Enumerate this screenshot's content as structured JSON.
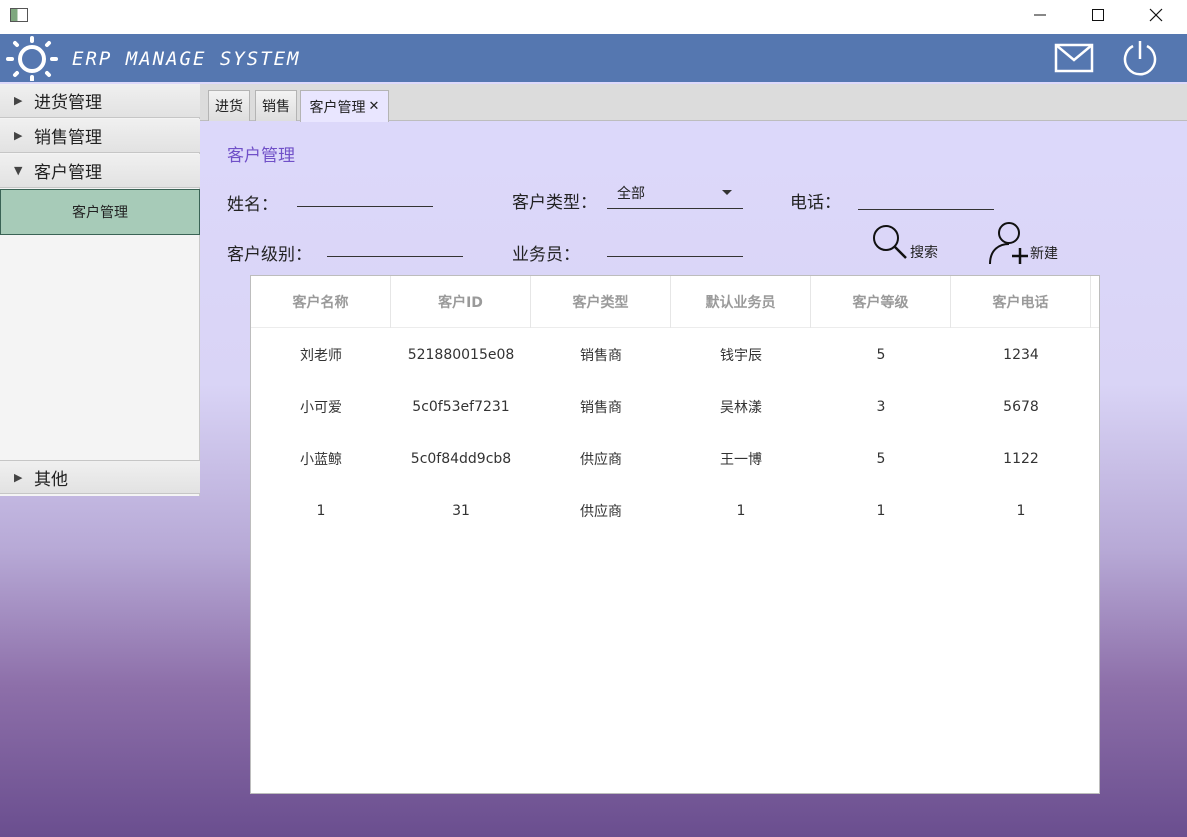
{
  "header": {
    "title": "ERP MANAGE SYSTEM"
  },
  "sidebar": {
    "sections": [
      {
        "label": "进货管理",
        "expanded": false
      },
      {
        "label": "销售管理",
        "expanded": false
      },
      {
        "label": "客户管理",
        "expanded": true,
        "children": [
          "客户管理"
        ]
      },
      {
        "label": "其他",
        "expanded": false
      }
    ]
  },
  "tabs": [
    {
      "label": "进货"
    },
    {
      "label": "销售"
    },
    {
      "label": "客户管理",
      "close": "✕",
      "active": true
    }
  ],
  "page": {
    "title": "客户管理",
    "fields": {
      "name": {
        "label": "姓名：",
        "value": ""
      },
      "type": {
        "label": "客户类型：",
        "value": "全部"
      },
      "phone": {
        "label": "电话：",
        "value": ""
      },
      "level": {
        "label": "客户级别：",
        "value": ""
      },
      "salesman": {
        "label": "业务员：",
        "value": ""
      }
    },
    "actions": {
      "search": "搜索",
      "create": "新建"
    }
  },
  "table": {
    "columns": [
      "客户名称",
      "客户ID",
      "客户类型",
      "默认业务员",
      "客户等级",
      "客户电话"
    ],
    "rows": [
      [
        "刘老师",
        "521880015e08",
        "销售商",
        "钱宇辰",
        "5",
        "1234"
      ],
      [
        "小可爱",
        "5c0f53ef7231",
        "销售商",
        "吴林漾",
        "3",
        "5678"
      ],
      [
        "小蓝鲸",
        "5c0f84dd9cb8",
        "供应商",
        "王一博",
        "5",
        "1122"
      ],
      [
        "1",
        "31",
        "供应商",
        "1",
        "1",
        "1"
      ]
    ]
  },
  "colors": {
    "header": "#5577b0",
    "accent": "#7050c8",
    "selected": "#a7cbb8"
  }
}
